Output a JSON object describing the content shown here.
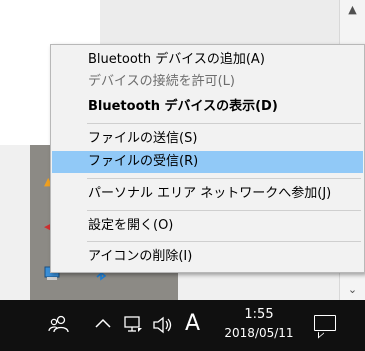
{
  "menu": {
    "items": [
      {
        "label": "Bluetooth デバイスの追加(A)",
        "state": "normal"
      },
      {
        "label": "デバイスの接続を許可(L)",
        "state": "disabled"
      },
      {
        "label": "Bluetooth デバイスの表示(D)",
        "state": "bold"
      },
      {
        "label": "ファイルの送信(S)",
        "state": "normal"
      },
      {
        "label": "ファイルの受信(R)",
        "state": "highlighted"
      },
      {
        "label": "パーソナル エリア ネットワークへ参加(J)",
        "state": "normal"
      },
      {
        "label": "設定を開く(O)",
        "state": "normal"
      },
      {
        "label": "アイコンの削除(I)",
        "state": "normal"
      }
    ]
  },
  "taskbar": {
    "ime_indicator": "A",
    "time": "1:55",
    "date": "2018/05/11",
    "icons": [
      "people-icon",
      "chevron-up-icon",
      "network-icon",
      "volume-icon",
      "notification-icon"
    ]
  },
  "tray_overflow": {
    "icons": [
      "app-icon-orange",
      "app-icon-red",
      "device-icon",
      "bluetooth-icon"
    ]
  },
  "colors": {
    "menu_bg": "#f2f2f2",
    "highlight": "#91c9f7",
    "taskbar_bg": "#101010",
    "tray_bg": "#8c8a85",
    "green_bar": "#1fa247"
  }
}
